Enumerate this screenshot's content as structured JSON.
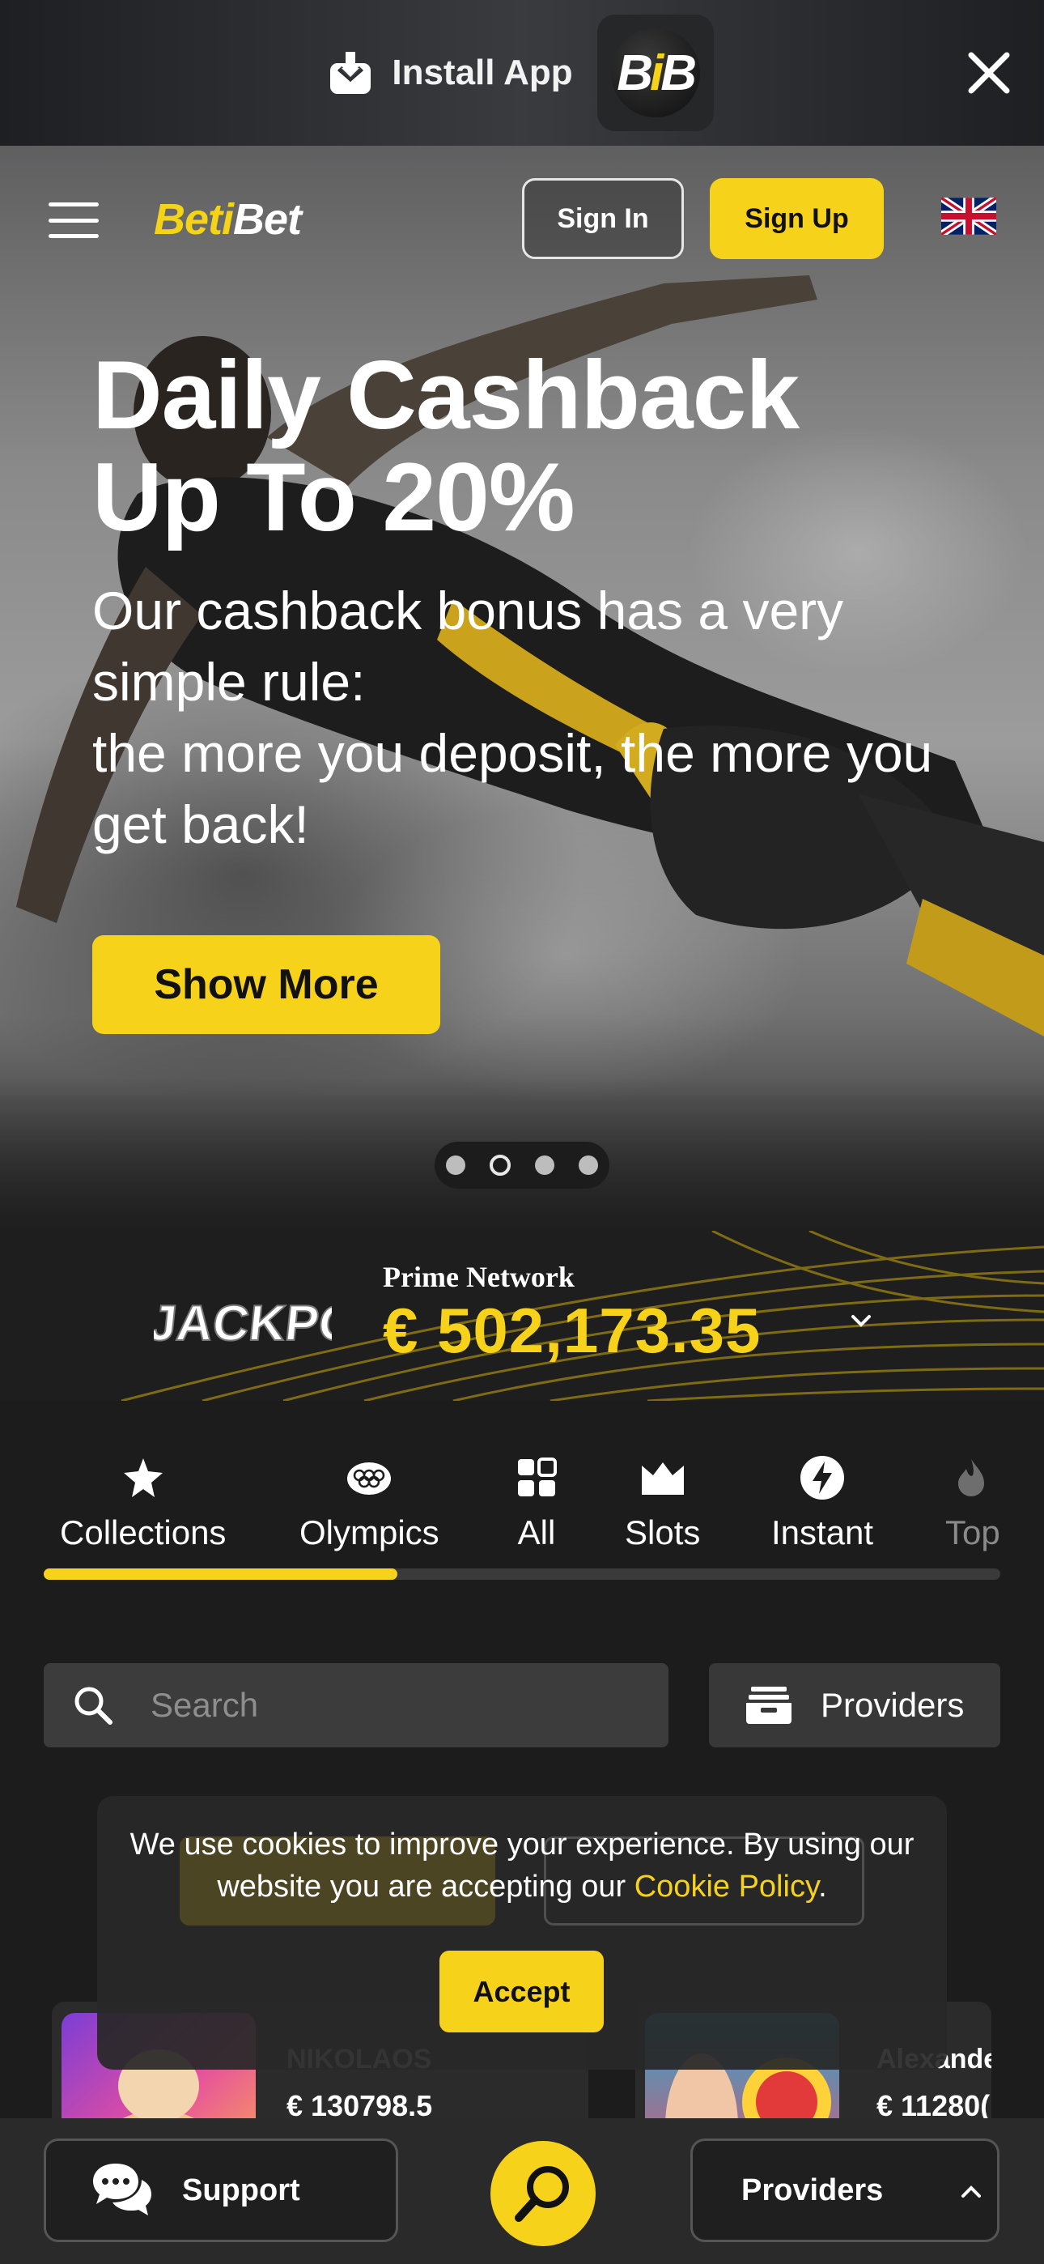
{
  "install_bar": {
    "label": "Install App",
    "logo_text_a": "B",
    "logo_text_b": "i",
    "logo_text_c": "B"
  },
  "header": {
    "brand_a": "Beti",
    "brand_b": "Bet",
    "sign_in": "Sign In",
    "sign_up": "Sign Up",
    "language": "English (UK flag)"
  },
  "hero": {
    "title_line1": "Daily Cashback",
    "title_line2": "Up To 20%",
    "text_line1": "Our cashback bonus has a very simple rule:",
    "text_line2": "the more you deposit, the more you get back!",
    "cta": "Show More",
    "slides_total": 4,
    "slide_active": 2
  },
  "jackpot": {
    "logo_text": "JACKPOT",
    "network": "Prime Network",
    "amount": "€ 502,173.35"
  },
  "categories": {
    "items": [
      {
        "label": "Collections",
        "icon": "star-badge-icon"
      },
      {
        "label": "Olympics",
        "icon": "olympic-rings-icon"
      },
      {
        "label": "All",
        "icon": "grid-icon"
      },
      {
        "label": "Slots",
        "icon": "crown-icon"
      },
      {
        "label": "Instant",
        "icon": "lightning-icon"
      },
      {
        "label": "Top",
        "icon": "flame-icon"
      }
    ],
    "scroll_progress": 0.37
  },
  "search": {
    "placeholder": "Search",
    "providers_label": "Providers"
  },
  "winners": [
    {
      "name": "NIKOLAOS",
      "amount": "€ 130798.5"
    },
    {
      "name": "Alexande",
      "amount": "€ 11280("
    }
  ],
  "cookie": {
    "text": "We use cookies to improve your experience. By using our website you are accepting our",
    "link": "Cookie Policy",
    "trailing": ".",
    "accept": "Accept"
  },
  "bottom_bar": {
    "support": "Support",
    "providers": "Providers"
  },
  "colors": {
    "accent": "#f7d21a",
    "background": "#1c1c1c"
  }
}
